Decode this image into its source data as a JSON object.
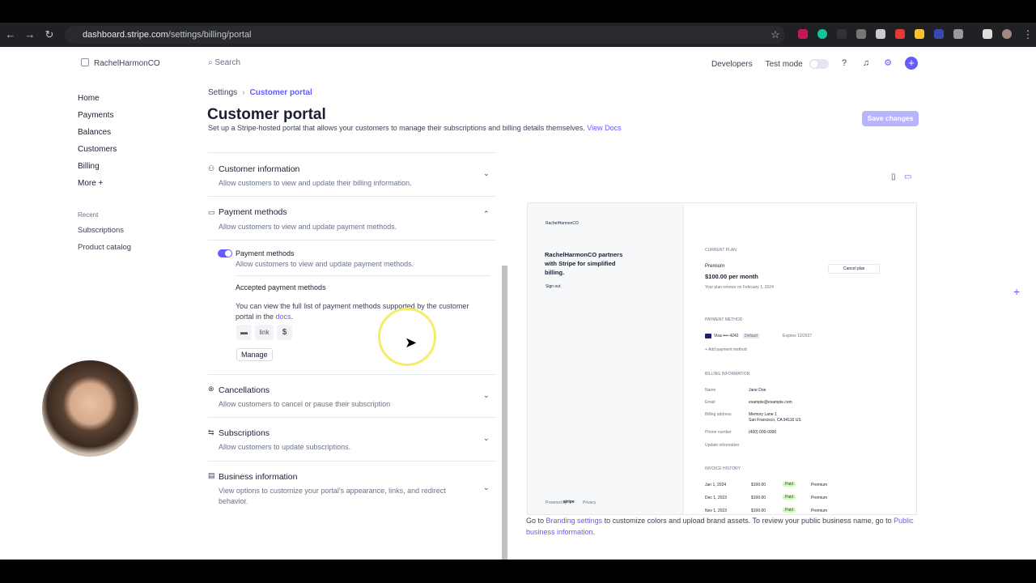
{
  "browser": {
    "url_host": "dashboard.stripe.com",
    "url_path": "/settings/billing/portal"
  },
  "topbar": {
    "workspace": "RachelHarmonCO",
    "search_placeholder": "Search",
    "developers": "Developers",
    "test_mode": "Test mode"
  },
  "sidebar": {
    "items": [
      "Home",
      "Payments",
      "Balances",
      "Customers",
      "Billing",
      "More +"
    ],
    "recent_label": "Recent",
    "recent": [
      "Subscriptions",
      "Product catalog"
    ]
  },
  "header": {
    "crumb_root": "Settings",
    "crumb_current": "Customer portal",
    "title": "Customer portal",
    "subtitle": "Set up a Stripe-hosted portal that allows your customers to manage their subscriptions and billing details themselves.",
    "view_docs": "View Docs",
    "save": "Save changes"
  },
  "sections": {
    "customer_info": {
      "title": "Customer information",
      "desc": "Allow customers to view and update their billing information."
    },
    "payment_methods": {
      "title": "Payment methods",
      "desc": "Allow customers to view and update payment methods."
    },
    "pm_toggle": {
      "title": "Payment methods",
      "desc": "Allow customers to view and update payment methods."
    },
    "accepted": {
      "title": "Accepted payment methods",
      "desc": "You can view the full list of payment methods supported by the customer portal in the",
      "docs": "docs",
      "period": ".",
      "link": "link",
      "manage": "Manage"
    },
    "cancellations": {
      "title": "Cancellations",
      "desc": "Allow customers to cancel or pause their subscription"
    },
    "subscriptions": {
      "title": "Subscriptions",
      "desc": "Allow customers to update subscriptions."
    },
    "business": {
      "title": "Business information",
      "desc": "View options to customize your portal's appearance, links, and redirect behavior."
    }
  },
  "preview": {
    "brand": "RachelHarmonCO",
    "tagline": "RachelHarmonCO partners with Stripe for simplified billing.",
    "sign_out": "Sign out",
    "powered": "Powered by",
    "stripe": "stripe",
    "privacy": "Privacy",
    "current_plan": "CURRENT PLAN",
    "plan_name": "Premium",
    "plan_price": "$100.00 per month",
    "renew": "Your plan renews on February 1, 2024",
    "cancel_plan": "Cancel plan",
    "payment_method": "PAYMENT METHOD",
    "card": "Visa •••• 4242",
    "default": "Default",
    "expires": "Expires 12/2027",
    "add_pm": "+ Add payment method",
    "billing_info": "BILLING INFORMATION",
    "name_label": "Name",
    "name": "Jane Doe",
    "email_label": "Email",
    "email": "example@example.com",
    "addr_label": "Billing address",
    "addr1": "Memory Lane 1",
    "addr2": "San Francisco, CA 94116 US",
    "phone_label": "Phone number",
    "phone": "(400) 000-0000",
    "update_info": "Update information",
    "invoice_history": "INVOICE HISTORY",
    "invoices": [
      {
        "date": "Jan 1, 2024",
        "amount": "$100.00",
        "status": "Paid",
        "plan": "Premium"
      },
      {
        "date": "Dec 1, 2023",
        "amount": "$100.00",
        "status": "Paid",
        "plan": "Premium"
      },
      {
        "date": "Nov 1, 2023",
        "amount": "$100.00",
        "status": "Paid",
        "plan": "Premium"
      }
    ]
  },
  "footer": {
    "pre": "Go to",
    "branding": "Branding settings",
    "mid": "to customize colors and upload brand assets. To review your public business name, go to",
    "public_info": "Public business information",
    "end": "."
  },
  "colors": {
    "accent": "#635bff",
    "save_disabled": "#b9b4ff"
  },
  "icons": [
    "back-icon",
    "forward-icon",
    "reload-icon",
    "star-icon",
    "help-icon",
    "bell-icon",
    "gear-icon",
    "plus-icon",
    "person-icon",
    "card-icon",
    "cancel-icon",
    "swap-icon",
    "building-icon",
    "chevron-down-icon",
    "chevron-up-icon",
    "mobile-icon",
    "desktop-icon"
  ]
}
